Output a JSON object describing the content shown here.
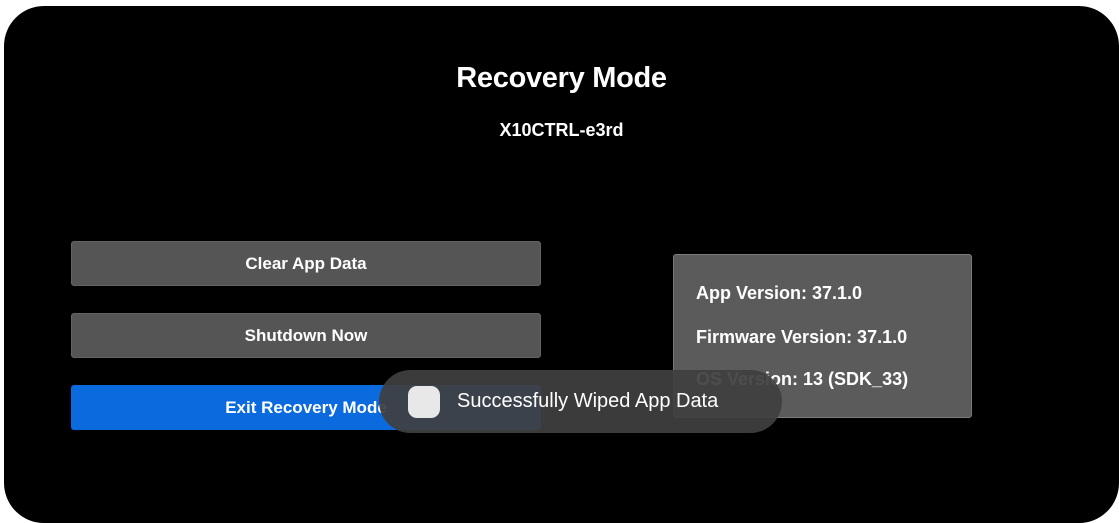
{
  "screen": {
    "title": "Recovery Mode",
    "device_id": "X10CTRL-e3rd"
  },
  "actions": {
    "clear_app_data": "Clear App Data",
    "shutdown_now": "Shutdown Now",
    "exit_recovery_mode": "Exit Recovery Mode"
  },
  "info": {
    "app_version": "App Version: 37.1.0",
    "firmware_version": "Firmware Version: 37.1.0",
    "os_version": "OS Version: 13 (SDK_33)"
  },
  "toast": {
    "icon": "app-icon",
    "message": "Successfully Wiped App Data"
  },
  "colors": {
    "background": "#000000",
    "button_grey": "#555555",
    "button_primary": "#0b6bde",
    "card": "#5b5b5b",
    "toast": "#404040"
  }
}
